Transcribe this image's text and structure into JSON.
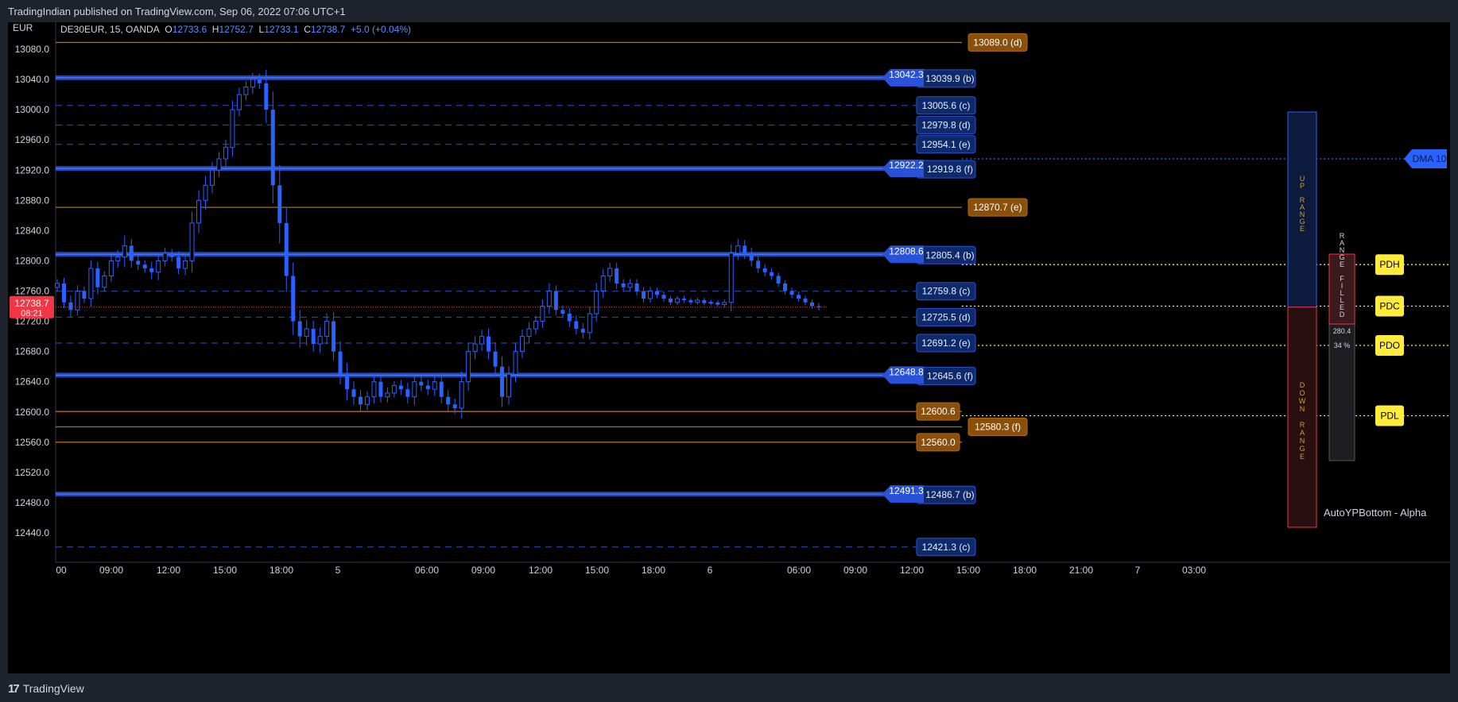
{
  "header": {
    "published": "TradingIndian published on TradingView.com, Sep 06, 2022 07:06 UTC+1"
  },
  "footer": {
    "brand": "TradingView"
  },
  "legend": {
    "symbol": "DE30EUR, 15, OANDA",
    "o_label": "O",
    "o": "12733.6",
    "h_label": "H",
    "h": "12752.7",
    "l_label": "L",
    "l": "12733.1",
    "c_label": "C",
    "c": "12738.7",
    "change": "+5.0 (+0.04%)"
  },
  "colors": {
    "background": "#000000",
    "candle": "#2962ff",
    "blue_level": "#2a52d8",
    "orange_level": "#b26b0f",
    "yellow": "#ffeb3b",
    "price_tag": "#f23645"
  },
  "chart_data": {
    "type": "candlestick",
    "currency": "EUR",
    "ylim": [
      12410,
      13100
    ],
    "y_ticks": [
      "13080.0",
      "13040.0",
      "13000.0",
      "12960.0",
      "12920.0",
      "12880.0",
      "12840.0",
      "12800.0",
      "12760.0",
      "12720.0",
      "12680.0",
      "12640.0",
      "12600.0",
      "12560.0",
      "12520.0",
      "12480.0",
      "12440.0"
    ],
    "x_ticks": [
      "00",
      "09:00",
      "12:00",
      "15:00",
      "18:00",
      "5",
      "06:00",
      "09:00",
      "12:00",
      "15:00",
      "18:00",
      "6",
      "06:00",
      "09:00",
      "12:00",
      "15:00",
      "18:00",
      "21:00",
      "7",
      "03:00"
    ],
    "last_price": "12738.7",
    "countdown": "08:21",
    "series_close": [
      12770,
      12745,
      12735,
      12760,
      12750,
      12790,
      12765,
      12780,
      12800,
      12805,
      12820,
      12800,
      12795,
      12790,
      12785,
      12800,
      12810,
      12805,
      12790,
      12800,
      12850,
      12880,
      12900,
      12920,
      12935,
      12950,
      13000,
      13020,
      13030,
      13040,
      13035,
      13000,
      12900,
      12850,
      12780,
      12720,
      12700,
      12710,
      12690,
      12700,
      12720,
      12680,
      12650,
      12630,
      12620,
      12610,
      12620,
      12640,
      12620,
      12625,
      12635,
      12630,
      12620,
      12640,
      12635,
      12630,
      12640,
      12620,
      12610,
      12605,
      12640,
      12680,
      12690,
      12700,
      12680,
      12660,
      12620,
      12650,
      12680,
      12700,
      12710,
      12720,
      12740,
      12760,
      12735,
      12730,
      12720,
      12710,
      12705,
      12730,
      12760,
      12780,
      12790,
      12770,
      12765,
      12770,
      12760,
      12750,
      12760,
      12755,
      12750,
      12745,
      12750,
      12748,
      12745,
      12748,
      12744,
      12745,
      12742,
      12745,
      12810,
      12820,
      12810,
      12800,
      12790,
      12785,
      12780,
      12770,
      12760,
      12755,
      12750,
      12745,
      12740,
      12738.7
    ],
    "series_range": [
      20,
      25,
      30,
      25,
      20,
      35,
      30,
      20,
      25,
      30,
      45,
      30,
      25,
      20,
      30,
      35,
      25,
      20,
      25,
      30,
      50,
      45,
      40,
      35,
      30,
      35,
      40,
      30,
      25,
      30,
      25,
      60,
      80,
      90,
      70,
      60,
      50,
      40,
      35,
      40,
      35,
      40,
      45,
      50,
      35,
      30,
      25,
      30,
      25,
      25,
      20,
      25,
      30,
      35,
      25,
      25,
      30,
      30,
      30,
      25,
      45,
      40,
      35,
      30,
      35,
      40,
      45,
      35,
      35,
      30,
      30,
      25,
      30,
      35,
      25,
      20,
      25,
      25,
      25,
      30,
      35,
      30,
      25,
      25,
      20,
      20,
      20,
      18,
      18,
      15,
      15,
      12,
      12,
      12,
      10,
      10,
      10,
      10,
      10,
      12,
      40,
      30,
      25,
      25,
      20,
      18,
      18,
      15,
      15,
      15,
      15,
      12,
      12,
      14
    ],
    "blue_levels": [
      {
        "price": 13042.3,
        "label": "13042.3",
        "tag": "13039.9 (b)"
      },
      {
        "price": 12922.2,
        "label": "12922.2",
        "tag": "12919.8 (f)"
      },
      {
        "price": 12808.6,
        "label": "12808.6",
        "tag": "12805.4 (b)"
      },
      {
        "price": 12648.8,
        "label": "12648.8",
        "tag": "12645.6 (f)"
      },
      {
        "price": 12491.3,
        "label": "12491.3",
        "tag": "12486.7 (b)"
      }
    ],
    "dashed_levels": [
      {
        "price": 13005.6,
        "tag": "13005.6 (c)"
      },
      {
        "price": 12979.8,
        "tag": "12979.8 (d)"
      },
      {
        "price": 12954.1,
        "tag": "12954.1 (e)"
      },
      {
        "price": 12759.8,
        "tag": "12759.8 (c)"
      },
      {
        "price": 12725.5,
        "tag": "12725.5 (d)"
      },
      {
        "price": 12691.2,
        "tag": "12691.2 (e)"
      },
      {
        "price": 12421.3,
        "tag": "12421.3 (c)"
      }
    ],
    "orange_levels": [
      {
        "price": 13089.0,
        "tag": "13089.0 (d)"
      },
      {
        "price": 12870.7,
        "tag": "12870.7 (e)"
      },
      {
        "price": 12600.6,
        "tag": "12600.6"
      },
      {
        "price": 12580.3,
        "tag": "12580.3 (f)"
      },
      {
        "price": 12560.0,
        "tag": "12560.0"
      }
    ],
    "prev_day_levels": [
      {
        "name": "PDH",
        "price": 12795
      },
      {
        "name": "PDC",
        "price": 12740
      },
      {
        "name": "PDO",
        "price": 12688
      },
      {
        "name": "PDL",
        "price": 12595
      }
    ],
    "dma": {
      "label": "DMA 10",
      "price": 12935
    },
    "up_range_label": "UP RANGE",
    "down_range_label": "DOWN RANGE",
    "range_filled_label": "RANGE FILLED",
    "range_value": "280.4",
    "range_percent": "34 %",
    "indicator_name": "AutoYPBottom - Alpha"
  }
}
